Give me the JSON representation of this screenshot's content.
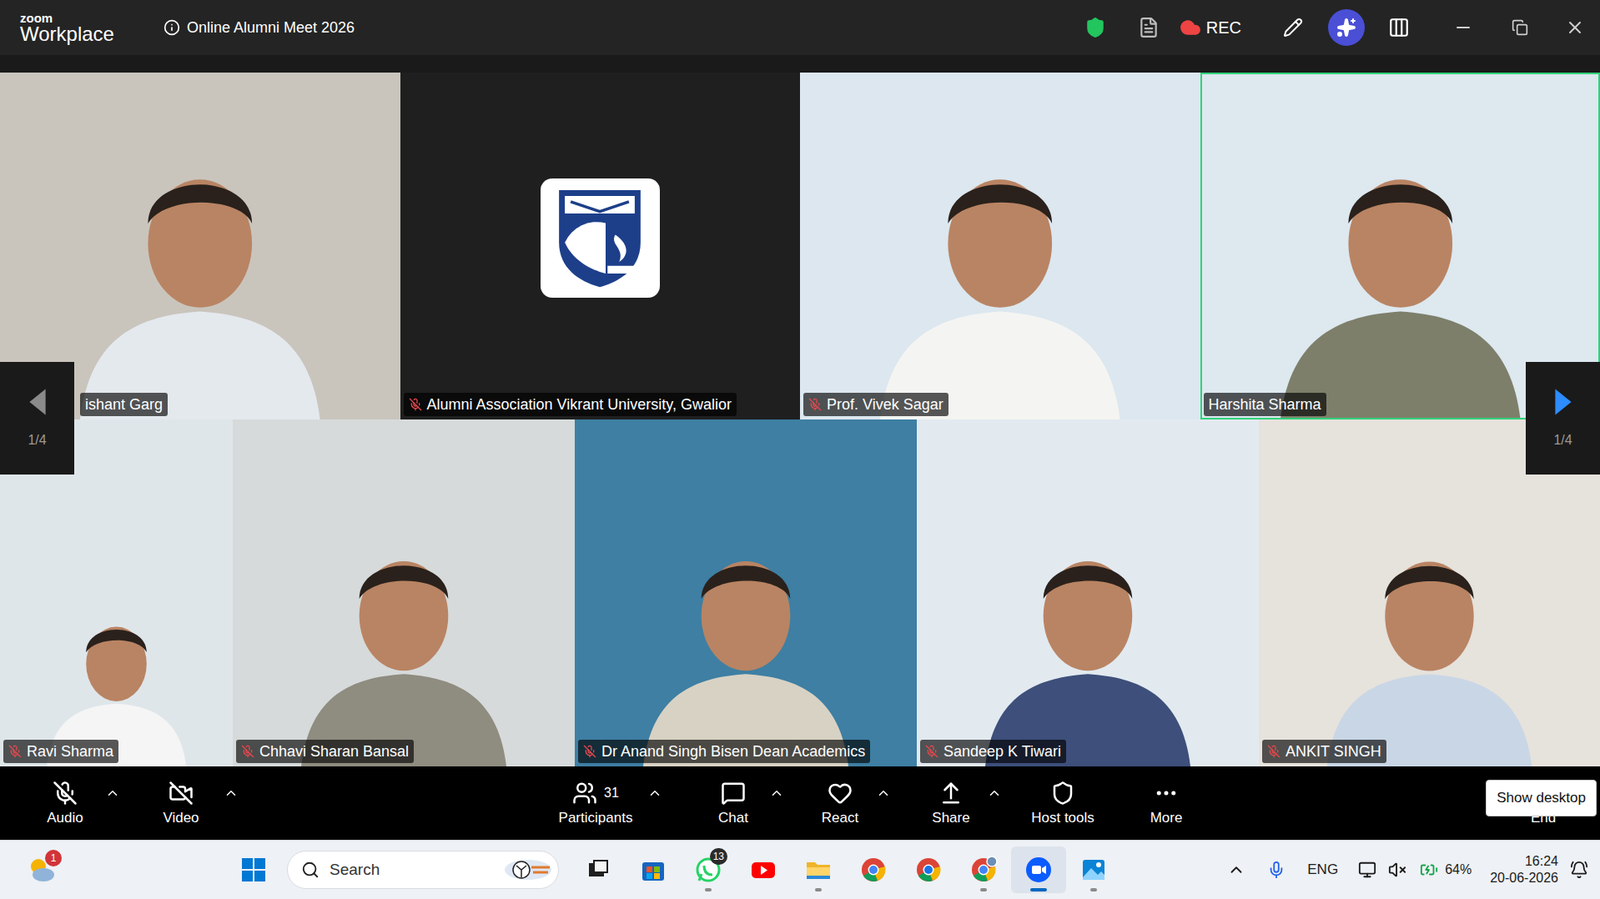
{
  "app": {
    "brand_top": "zoom",
    "brand_bottom": "Workplace"
  },
  "meeting": {
    "title": "Online Alumni Meet 2026"
  },
  "recording": {
    "label": "REC",
    "on": true
  },
  "tiles": [
    {
      "name": "ishant Garg",
      "muted": false,
      "active": false,
      "kind": "video",
      "color": "#c9c5bd",
      "shirt": "#e4e9ee"
    },
    {
      "name": "Alumni Association Vikrant University, Gwalior",
      "muted": true,
      "active": false,
      "kind": "avatar",
      "color": "#1f1f1f",
      "shirt": "#1f1f1f"
    },
    {
      "name": "Prof. Vivek Sagar",
      "muted": true,
      "active": false,
      "kind": "video",
      "color": "#dce7ef",
      "shirt": "#f4f4f2"
    },
    {
      "name": "Harshita Sharma",
      "muted": false,
      "active": true,
      "kind": "video",
      "color": "#dde8ef",
      "shirt": "#7d7f6a"
    },
    {
      "name": "Ravi Sharma",
      "muted": true,
      "active": false,
      "kind": "video",
      "color": "#dfe6ea",
      "shirt": "#f5f5f5"
    },
    {
      "name": "Chhavi Sharan Bansal",
      "muted": true,
      "active": false,
      "kind": "video",
      "color": "#d6dada",
      "shirt": "#8f8c80"
    },
    {
      "name": "Dr Anand Singh Bisen Dean Academics",
      "muted": true,
      "active": false,
      "kind": "video",
      "color": "#3e7fa3",
      "shirt": "#d8d2c4"
    },
    {
      "name": "Sandeep K Tiwari",
      "muted": true,
      "active": false,
      "kind": "video",
      "color": "#e2eaf0",
      "shirt": "#3d4f7a"
    },
    {
      "name": "ANKIT SINGH",
      "muted": true,
      "active": false,
      "kind": "video",
      "color": "#e6e2dc",
      "shirt": "#c9d6e6"
    }
  ],
  "pager": {
    "left": "1/4",
    "right": "1/4"
  },
  "toolbar": {
    "items": [
      {
        "label": "Audio",
        "kind": "audio",
        "off": true,
        "menu": true
      },
      {
        "label": "Video",
        "kind": "video",
        "off": true,
        "menu": true
      },
      {
        "label": "Participants",
        "kind": "participants",
        "count": "31",
        "off": false,
        "menu": true
      },
      {
        "label": "Chat",
        "kind": "chat",
        "off": false,
        "menu": true
      },
      {
        "label": "React",
        "kind": "react",
        "off": false,
        "menu": true
      },
      {
        "label": "Share",
        "kind": "share",
        "off": false,
        "menu": true
      },
      {
        "label": "Host tools",
        "kind": "host",
        "off": false,
        "menu": false
      },
      {
        "label": "More",
        "kind": "more",
        "off": false,
        "menu": false
      }
    ],
    "end": "End",
    "tooltip": "Show desktop"
  },
  "taskbar": {
    "weather_badge": "1",
    "search": {
      "placeholder": "Search"
    },
    "apps": [
      {
        "kind": "search-highlight",
        "running": false,
        "active": false
      },
      {
        "kind": "task-view",
        "running": false,
        "active": false
      },
      {
        "kind": "store",
        "running": false,
        "active": false
      },
      {
        "kind": "whatsapp",
        "badge": "13",
        "running": true,
        "active": false
      },
      {
        "kind": "youtube",
        "running": false,
        "active": false
      },
      {
        "kind": "explorer",
        "running": true,
        "active": false
      },
      {
        "kind": "chrome",
        "running": false,
        "active": false
      },
      {
        "kind": "chrome-alt",
        "running": false,
        "active": false
      },
      {
        "kind": "chrome-profile",
        "running": true,
        "active": false
      },
      {
        "kind": "zoom",
        "running": true,
        "active": true
      },
      {
        "kind": "photos",
        "running": true,
        "active": false
      }
    ],
    "tray": {
      "language": "ENG",
      "battery": "64%",
      "time": "16:24",
      "date": "20-06-2026"
    }
  }
}
